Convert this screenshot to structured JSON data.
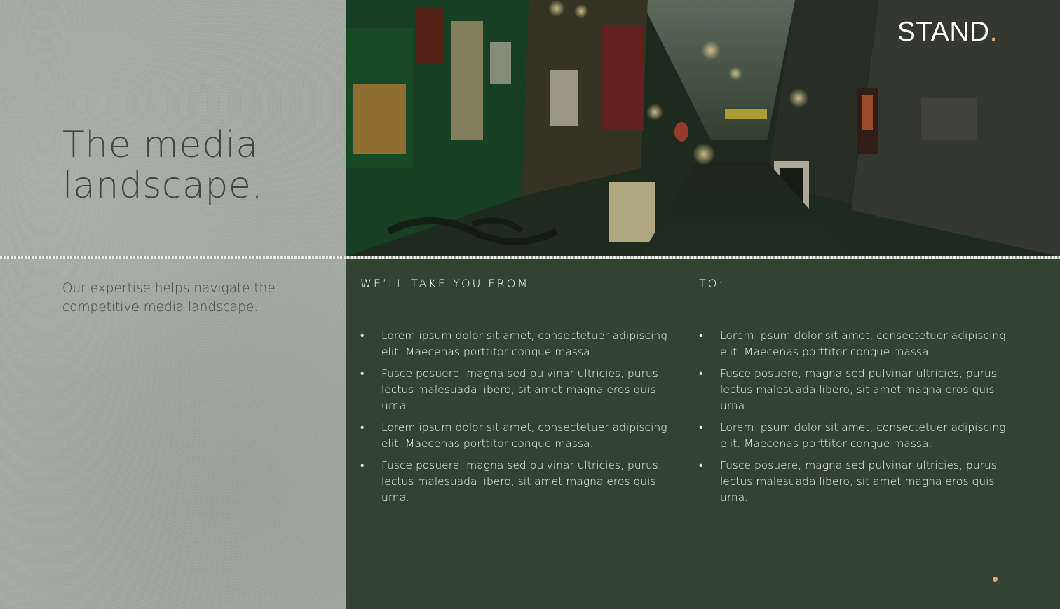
{
  "title": "The media\nlandscape.",
  "subtitle": "Our expertise helps navigate the competitive media landscape.",
  "logo": {
    "text": "STAND",
    "dot": "."
  },
  "from": {
    "heading": "WE’LL TAKE YOU FROM:",
    "items": [
      "Lorem ipsum dolor sit amet, consectetuer adipiscing elit. Maecenas porttitor congue massa.",
      "Fusce posuere, magna sed pulvinar ultricies, purus lectus malesuada libero, sit amet magna eros quis urna.",
      "Lorem ipsum dolor sit amet, consectetuer adipiscing elit. Maecenas porttitor congue massa.",
      "Fusce posuere, magna sed pulvinar ultricies, purus lectus malesuada libero, sit amet magna eros quis urna."
    ]
  },
  "to": {
    "heading": "TO:",
    "items": [
      "Lorem ipsum dolor sit amet, consectetuer adipiscing elit. Maecenas porttitor congue massa.",
      "Fusce posuere, magna sed pulvinar ultricies, purus lectus malesuada libero, sit amet  magna eros quis urna.",
      "Lorem ipsum dolor sit amet, consectetuer adipiscing elit. Maecenas porttitor congue massa.",
      "Fusce posuere, magna sed pulvinar ultricies, purus lectus malesuada libero, sit amet magna eros quis urna."
    ]
  },
  "bullet": "•",
  "colors": {
    "panel_green": "#334332",
    "stone_gray": "#a4aaa3",
    "accent": "#e2a07a"
  }
}
